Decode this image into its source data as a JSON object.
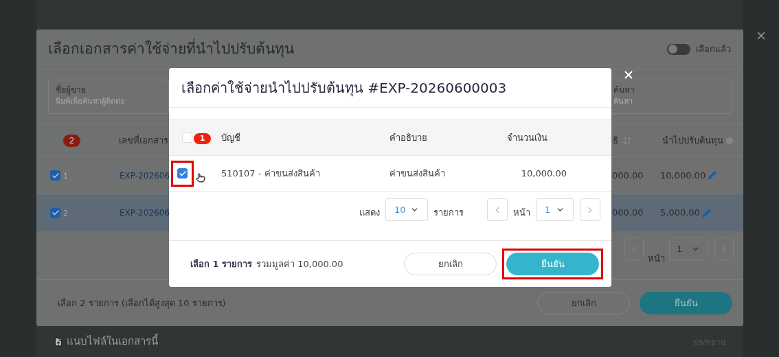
{
  "page": {
    "attachments_label": "แนบไฟล์ในเอกสารนี้",
    "collapse_link": "ย่อ/ขยาย"
  },
  "outer_dialog": {
    "title": "เลือกเอกสารค่าใช้จ่ายที่นำไปปรับต้นทุน",
    "toggle": {
      "label": "เลือกแล้ว",
      "on": false
    },
    "vendor_filter": {
      "label": "ชื่อผู้ขาย",
      "placeholder": "พิมพ์เพื่อค้นหาผู้ติดต่อ"
    },
    "search_filter": {
      "label": "ค้นหา",
      "placeholder": "ค้นหา"
    },
    "table": {
      "selected_count": "2",
      "columns": [
        "เลขที่เอกสาร",
        "ธิ",
        "นำไปปรับต้นทุน"
      ],
      "rows": [
        {
          "checked": true,
          "selected": false,
          "index": "1",
          "document": "EXP-202606",
          "amount": "000.00",
          "adjusted": "10,000.00"
        },
        {
          "checked": true,
          "selected": true,
          "index": "2",
          "document": "EXP-202606",
          "amount": "000.00",
          "adjusted": "5,000.00"
        }
      ]
    },
    "pagination": {
      "page_label": "หน้า",
      "page": "1"
    },
    "summary": "เลือก 2 รายการ (เลือกได้สูงสุด 10 รายการ)",
    "buttons": [
      {
        "label": "ยกเลิก",
        "kind": "secondary"
      },
      {
        "label": "ยืนยัน",
        "kind": "primary"
      }
    ]
  },
  "dialog": {
    "title": "เลือกค่าใช้จ่ายนำไปปรับต้นทุน #EXP-20260600003",
    "table": {
      "all_checked": false,
      "selected_count": "1",
      "columns": [
        "บัญชี",
        "คำอธิบาย",
        "จำนวนเงิน"
      ],
      "rows": [
        {
          "checked": true,
          "highlighted": true,
          "account": "510107 - ค่าขนส่งสินค้า",
          "description": "ค่าขนส่งสินค้า",
          "amount": "10,000.00"
        }
      ]
    },
    "pagination": {
      "show_label": "แสดง",
      "page_size": "10",
      "items_label": "รายการ",
      "page_label": "หน้า",
      "page": "1"
    },
    "footer": {
      "selected_text": "เลือก 1 รายการ",
      "total_text": "รวมมูลค่า 10,000.00"
    },
    "buttons": [
      {
        "label": "ยกเลิก",
        "kind": "secondary",
        "highlighted": false
      },
      {
        "label": "ยืนยัน",
        "kind": "primary",
        "highlighted": true
      }
    ]
  }
}
